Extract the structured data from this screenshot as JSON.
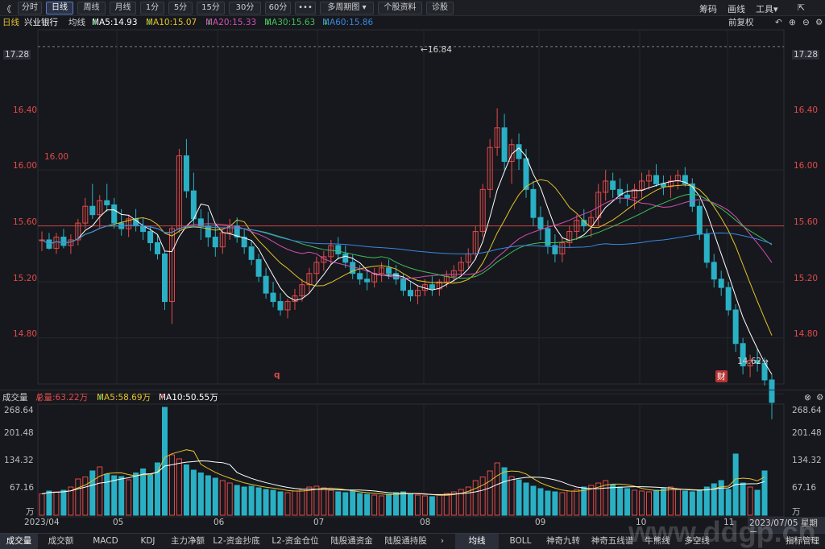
{
  "toolbar": {
    "back": "《",
    "periods": [
      "分时",
      "日线",
      "周线",
      "月线",
      "1分",
      "5分",
      "15分",
      "30分",
      "60分"
    ],
    "active_period": "日线",
    "more": "•••",
    "multi": "多周期图",
    "profile": "个股资料",
    "diagnose": "诊股",
    "chip": "筹码",
    "draw": "画线",
    "tools": "工具",
    "extra": "⇱"
  },
  "info": {
    "period": "日线",
    "stock": "兴业银行",
    "ma_label": "均线",
    "ma5": "MA5:14.93",
    "ma10": "MA10:15.07",
    "ma20": "MA20:15.33",
    "ma30": "MA30:15.63",
    "ma60": "MA60:15.86",
    "restore": "前复权"
  },
  "price_axis": [
    "17.28",
    "16.40",
    "16.00",
    "15.60",
    "15.20",
    "14.80"
  ],
  "annotations": {
    "high": "16.84",
    "low": "14.62",
    "ref": "16.00",
    "q": "q",
    "cai": "财"
  },
  "volume_info": {
    "title": "成交量",
    "total": "总量:63.22万",
    "ma5": "MA5:58.69万",
    "ma10": "MA10:50.55万"
  },
  "volume_axis": [
    "268.64",
    "201.48",
    "134.32",
    "67.16",
    "万"
  ],
  "dates": [
    "2023/04",
    "05",
    "06",
    "07",
    "08",
    "09",
    "10",
    "11"
  ],
  "date_current": "2023/07/05 星期三",
  "bottom_left": [
    "成交量",
    "成交额",
    "MACD",
    "KDJ",
    "主力净额",
    "L2-资金抄底",
    "L2-资金仓位",
    "陆股通资金",
    "陆股通持股"
  ],
  "bottom_right": [
    "均线",
    "BOLL",
    "神奇九转",
    "神奇五线谱",
    "牛熊线",
    "多空线",
    "指标管理"
  ],
  "watermark": "www.ddgp.cn",
  "colors": {
    "up": "#e24a4a",
    "down": "#2ab0c4",
    "ma5": "#ffffff",
    "ma10": "#e6c229",
    "ma20": "#d54fb3",
    "ma30": "#3fbf57",
    "ma60": "#3b86e0"
  },
  "chart_data": {
    "type": "candlestick",
    "title": "兴业银行 日线",
    "ylim": [
      14.6,
      17.3
    ],
    "x_start": "2023/04",
    "ohlc": [
      [
        15.9,
        15.96,
        15.82,
        15.9
      ],
      [
        15.9,
        15.95,
        15.83,
        15.84
      ],
      [
        15.84,
        15.95,
        15.8,
        15.92
      ],
      [
        15.92,
        15.98,
        15.84,
        15.86
      ],
      [
        15.86,
        15.94,
        15.8,
        15.9
      ],
      [
        15.9,
        16.05,
        15.86,
        16.02
      ],
      [
        16.02,
        16.2,
        15.98,
        16.14
      ],
      [
        16.14,
        16.3,
        16.05,
        16.08
      ],
      [
        16.08,
        16.22,
        15.98,
        16.18
      ],
      [
        16.18,
        16.3,
        16.1,
        16.15
      ],
      [
        16.15,
        16.2,
        15.98,
        16.02
      ],
      [
        16.02,
        16.12,
        15.93,
        15.98
      ],
      [
        15.98,
        16.08,
        15.92,
        16.05
      ],
      [
        16.05,
        16.12,
        15.96,
        16.0
      ],
      [
        16.0,
        16.06,
        15.9,
        15.96
      ],
      [
        15.96,
        16.0,
        15.82,
        15.88
      ],
      [
        15.88,
        15.94,
        15.76,
        15.8
      ],
      [
        15.8,
        15.82,
        15.4,
        15.46
      ],
      [
        15.46,
        16.0,
        15.3,
        15.98
      ],
      [
        15.98,
        16.55,
        15.95,
        16.5
      ],
      [
        16.5,
        16.62,
        16.2,
        16.25
      ],
      [
        16.25,
        16.38,
        16.0,
        16.05
      ],
      [
        16.05,
        16.12,
        15.9,
        16.0
      ],
      [
        16.0,
        16.1,
        15.85,
        15.92
      ],
      [
        15.92,
        16.02,
        15.78,
        15.85
      ],
      [
        15.85,
        15.98,
        15.8,
        15.95
      ],
      [
        15.95,
        16.05,
        15.9,
        16.0
      ],
      [
        16.0,
        16.06,
        15.88,
        15.92
      ],
      [
        15.92,
        15.98,
        15.8,
        15.85
      ],
      [
        15.85,
        15.9,
        15.72,
        15.76
      ],
      [
        15.76,
        15.8,
        15.6,
        15.64
      ],
      [
        15.64,
        15.7,
        15.48,
        15.52
      ],
      [
        15.52,
        15.6,
        15.42,
        15.46
      ],
      [
        15.46,
        15.52,
        15.36,
        15.4
      ],
      [
        15.4,
        15.48,
        15.34,
        15.46
      ],
      [
        15.46,
        15.55,
        15.4,
        15.5
      ],
      [
        15.5,
        15.62,
        15.46,
        15.58
      ],
      [
        15.58,
        15.7,
        15.52,
        15.66
      ],
      [
        15.66,
        15.78,
        15.6,
        15.74
      ],
      [
        15.74,
        15.82,
        15.68,
        15.78
      ],
      [
        15.78,
        15.9,
        15.72,
        15.86
      ],
      [
        15.86,
        15.92,
        15.76,
        15.8
      ],
      [
        15.8,
        15.86,
        15.7,
        15.74
      ],
      [
        15.74,
        15.8,
        15.62,
        15.66
      ],
      [
        15.66,
        15.72,
        15.58,
        15.62
      ],
      [
        15.62,
        15.68,
        15.54,
        15.6
      ],
      [
        15.6,
        15.7,
        15.56,
        15.66
      ],
      [
        15.66,
        15.74,
        15.6,
        15.7
      ],
      [
        15.7,
        15.76,
        15.62,
        15.66
      ],
      [
        15.66,
        15.72,
        15.58,
        15.62
      ],
      [
        15.62,
        15.66,
        15.5,
        15.54
      ],
      [
        15.54,
        15.6,
        15.46,
        15.5
      ],
      [
        15.5,
        15.58,
        15.44,
        15.54
      ],
      [
        15.54,
        15.62,
        15.5,
        15.58
      ],
      [
        15.58,
        15.64,
        15.5,
        15.55
      ],
      [
        15.55,
        15.62,
        15.5,
        15.6
      ],
      [
        15.6,
        15.68,
        15.56,
        15.64
      ],
      [
        15.64,
        15.72,
        15.6,
        15.68
      ],
      [
        15.68,
        15.78,
        15.64,
        15.74
      ],
      [
        15.74,
        15.84,
        15.7,
        15.8
      ],
      [
        15.8,
        16.0,
        15.76,
        15.96
      ],
      [
        15.96,
        16.3,
        15.92,
        16.26
      ],
      [
        16.26,
        16.62,
        16.2,
        16.56
      ],
      [
        16.56,
        16.84,
        16.5,
        16.7
      ],
      [
        16.7,
        16.8,
        16.4,
        16.46
      ],
      [
        16.46,
        16.62,
        16.3,
        16.58
      ],
      [
        16.58,
        16.66,
        16.4,
        16.48
      ],
      [
        16.48,
        16.55,
        16.2,
        16.26
      ],
      [
        16.26,
        16.32,
        16.0,
        16.06
      ],
      [
        16.06,
        16.14,
        15.9,
        15.98
      ],
      [
        15.98,
        16.04,
        15.8,
        15.86
      ],
      [
        15.86,
        15.94,
        15.74,
        15.8
      ],
      [
        15.8,
        15.92,
        15.74,
        15.88
      ],
      [
        15.88,
        16.0,
        15.84,
        15.96
      ],
      [
        15.96,
        16.08,
        15.9,
        16.04
      ],
      [
        16.04,
        16.12,
        15.96,
        16.0
      ],
      [
        16.0,
        16.1,
        15.92,
        16.06
      ],
      [
        16.06,
        16.3,
        16.0,
        16.24
      ],
      [
        16.24,
        16.4,
        16.18,
        16.32
      ],
      [
        16.32,
        16.38,
        16.2,
        16.26
      ],
      [
        16.26,
        16.34,
        16.16,
        16.22
      ],
      [
        16.22,
        16.3,
        16.14,
        16.2
      ],
      [
        16.2,
        16.3,
        16.12,
        16.26
      ],
      [
        16.26,
        16.38,
        16.2,
        16.32
      ],
      [
        16.32,
        16.4,
        16.26,
        16.36
      ],
      [
        16.36,
        16.44,
        16.28,
        16.3
      ],
      [
        16.3,
        16.36,
        16.22,
        16.28
      ],
      [
        16.28,
        16.36,
        16.2,
        16.32
      ],
      [
        16.32,
        16.4,
        16.26,
        16.36
      ],
      [
        16.36,
        16.42,
        16.28,
        16.3
      ],
      [
        16.3,
        16.34,
        16.1,
        16.14
      ],
      [
        16.14,
        16.18,
        15.9,
        15.94
      ],
      [
        15.94,
        15.98,
        15.7,
        15.74
      ],
      [
        15.74,
        15.8,
        15.56,
        15.62
      ],
      [
        15.62,
        15.68,
        15.5,
        15.56
      ],
      [
        15.56,
        15.6,
        15.36,
        15.4
      ],
      [
        15.4,
        15.44,
        15.1,
        15.16
      ],
      [
        15.16,
        15.2,
        14.94,
        15.0
      ],
      [
        15.0,
        15.08,
        14.92,
        15.04
      ],
      [
        15.04,
        15.12,
        14.96,
        15.02
      ],
      [
        15.02,
        15.06,
        14.86,
        14.9
      ],
      [
        14.9,
        14.94,
        14.62,
        14.74
      ]
    ],
    "volume_wan": [
      53,
      60,
      58,
      62,
      70,
      90,
      95,
      110,
      120,
      102,
      98,
      96,
      88,
      105,
      115,
      100,
      130,
      268,
      150,
      140,
      125,
      112,
      105,
      98,
      92,
      86,
      80,
      74,
      70,
      72,
      68,
      64,
      62,
      58,
      56,
      60,
      64,
      70,
      72,
      68,
      62,
      58,
      56,
      60,
      54,
      52,
      50,
      48,
      52,
      56,
      58,
      54,
      50,
      48,
      46,
      50,
      54,
      58,
      64,
      70,
      86,
      95,
      110,
      130,
      118,
      96,
      88,
      80,
      72,
      66,
      60,
      58,
      56,
      60,
      64,
      70,
      74,
      80,
      86,
      76,
      70,
      66,
      62,
      60,
      58,
      62,
      66,
      70,
      64,
      60,
      58,
      62,
      70,
      78,
      86,
      64,
      152,
      80,
      70,
      62,
      110
    ],
    "ma5_vol": 58.69,
    "ma10_vol": 50.55,
    "total_vol": 63.22
  }
}
